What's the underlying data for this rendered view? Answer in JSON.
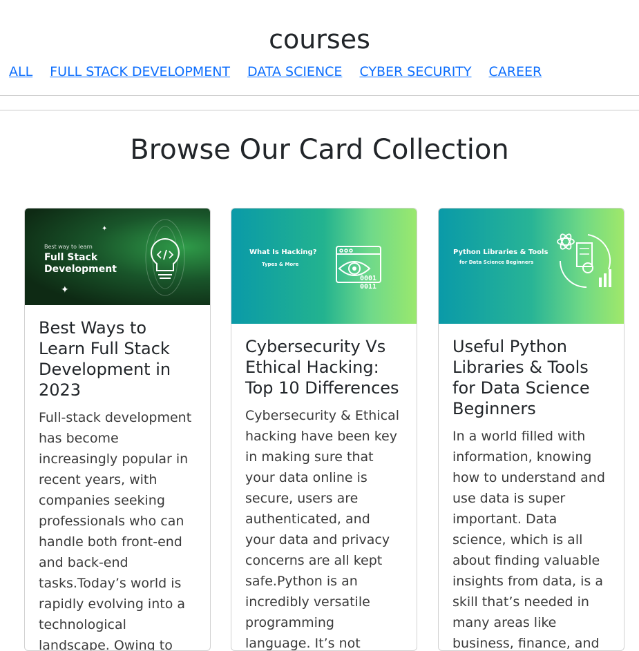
{
  "header": {
    "title": "courses",
    "nav": [
      "ALL",
      "FULL STACK DEVELOPMENT",
      "DATA SCIENCE",
      "CYBER SECURITY",
      "CAREER"
    ]
  },
  "collection": {
    "title": "Browse Our Card Collection",
    "cards": [
      {
        "thumb_small": "Best way to learn",
        "thumb_line1": "Full Stack",
        "thumb_line2": "Development",
        "title": "Best Ways to Learn Full Stack Development in 2023",
        "text": "Full-stack development has become increasingly popular in recent years, with companies seeking professionals who can handle both front-end and back-end tasks.Today’s world is rapidly evolving into a technological landscape. Owing to these dynamics,"
      },
      {
        "thumb_line1": "What Is Hacking?",
        "thumb_line2": "Types & More",
        "thumb_code1": "0001",
        "thumb_code2": "0011",
        "title": "Cybersecurity Vs Ethical Hacking: Top 10 Differences",
        "text": "Cybersecurity & Ethical hacking have been key in making sure that your data online is secure, users are authenticated, and your data and privacy concerns are all kept safe.Python is an incredibly versatile programming language. It’s not limited to just one"
      },
      {
        "thumb_line1": "Python Libraries & Tools",
        "thumb_line2": "for Data Science Beginners",
        "title": "Useful Python Libraries & Tools for Data Science Beginners",
        "text": "In a world filled with information, knowing how to understand and use data is super important. Data science, which is all about finding valuable insights from data, is a skill that’s needed in many areas like business, finance, and"
      }
    ]
  }
}
